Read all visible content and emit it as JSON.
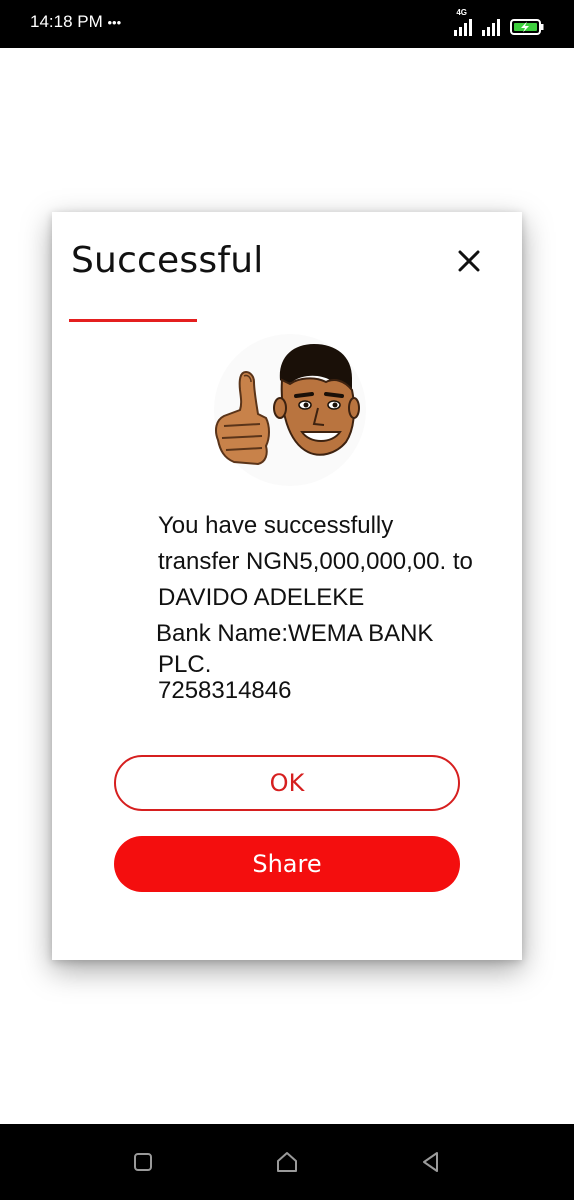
{
  "status_bar": {
    "time": "14:18 PM",
    "dots": "•••",
    "network_label": "4G",
    "icons": [
      "signal-icon",
      "signal-icon",
      "battery-charging-icon"
    ]
  },
  "dialog": {
    "title": "Successful",
    "close_icon": "close-icon",
    "accent_color": "#e41f1f",
    "message_line1": "You have successfully",
    "message_line2": "transfer NGN5,000,000,00. to",
    "message_line3": "DAVIDO ADELEKE",
    "bank_line1": "Bank Name:WEMA BANK",
    "bank_line2": "PLC.",
    "account_number": "7258314846",
    "ok_label": "OK",
    "share_label": "Share",
    "share_color": "#f40e0e"
  },
  "nav_bar": {
    "items": [
      "recents-icon",
      "home-icon",
      "back-icon"
    ]
  }
}
